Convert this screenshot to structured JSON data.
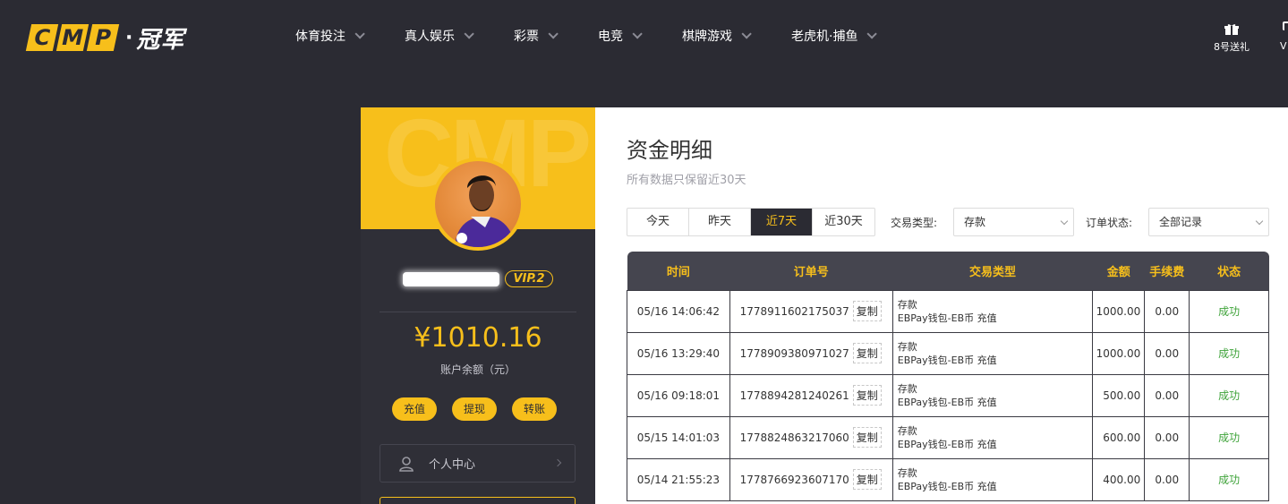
{
  "header": {
    "logo_letters": [
      "C",
      "M",
      "P"
    ],
    "logo_cn": "冠军",
    "nav": [
      {
        "label": "体育投注"
      },
      {
        "label": "真人娱乐"
      },
      {
        "label": "彩票"
      },
      {
        "label": "电竞"
      },
      {
        "label": "棋牌游戏"
      },
      {
        "label": "老虎机·捕鱼"
      }
    ],
    "gift_label": "8号送礼",
    "vip_cut_label": "V"
  },
  "profile": {
    "banner_text": "CMP",
    "vip_level": "VIP.2",
    "balance": "¥1010.16",
    "balance_label": "账户余额（元）",
    "actions": [
      {
        "label": "充值"
      },
      {
        "label": "提现"
      },
      {
        "label": "转账"
      }
    ],
    "menu": [
      {
        "label": "个人中心"
      }
    ]
  },
  "main": {
    "title": "资金明细",
    "subtitle": "所有数据只保留近30天",
    "tabs": [
      {
        "label": "今天",
        "active": false
      },
      {
        "label": "昨天",
        "active": false
      },
      {
        "label": "近7天",
        "active": true
      },
      {
        "label": "近30天",
        "active": false
      }
    ],
    "filter_type_label": "交易类型:",
    "filter_type_value": "存款",
    "filter_status_label": "订单状态:",
    "filter_status_value": "全部记录",
    "columns": [
      "时间",
      "订单号",
      "交易类型",
      "金额",
      "手续费",
      "状态"
    ],
    "copy_label": "复制",
    "rows": [
      {
        "time": "05/16 14:06:42",
        "order": "1778911602175037",
        "type": "存款",
        "type_detail": "EBPay钱包-EB币 充值",
        "amount": "1000.00",
        "fee": "0.00",
        "status": "成功"
      },
      {
        "time": "05/16 13:29:40",
        "order": "1778909380971027",
        "type": "存款",
        "type_detail": "EBPay钱包-EB币 充值",
        "amount": "1000.00",
        "fee": "0.00",
        "status": "成功"
      },
      {
        "time": "05/16 09:18:01",
        "order": "1778894281240261",
        "type": "存款",
        "type_detail": "EBPay钱包-EB币 充值",
        "amount": "500.00",
        "fee": "0.00",
        "status": "成功"
      },
      {
        "time": "05/15 14:01:03",
        "order": "1778824863217060",
        "type": "存款",
        "type_detail": "EBPay钱包-EB币 充值",
        "amount": "600.00",
        "fee": "0.00",
        "status": "成功"
      },
      {
        "time": "05/14 21:55:23",
        "order": "1778766923607170",
        "type": "存款",
        "type_detail": "EBPay钱包-EB币 充值",
        "amount": "400.00",
        "fee": "0.00",
        "status": "成功"
      }
    ]
  },
  "colors": {
    "accent": "#f7bf1b",
    "header_bg": "#2b2b33",
    "table_head": "#45454f",
    "success": "#3fa33a"
  },
  "icons": [
    "chevron-down-icon",
    "gift-icon",
    "person-icon",
    "chevron-right-icon"
  ]
}
